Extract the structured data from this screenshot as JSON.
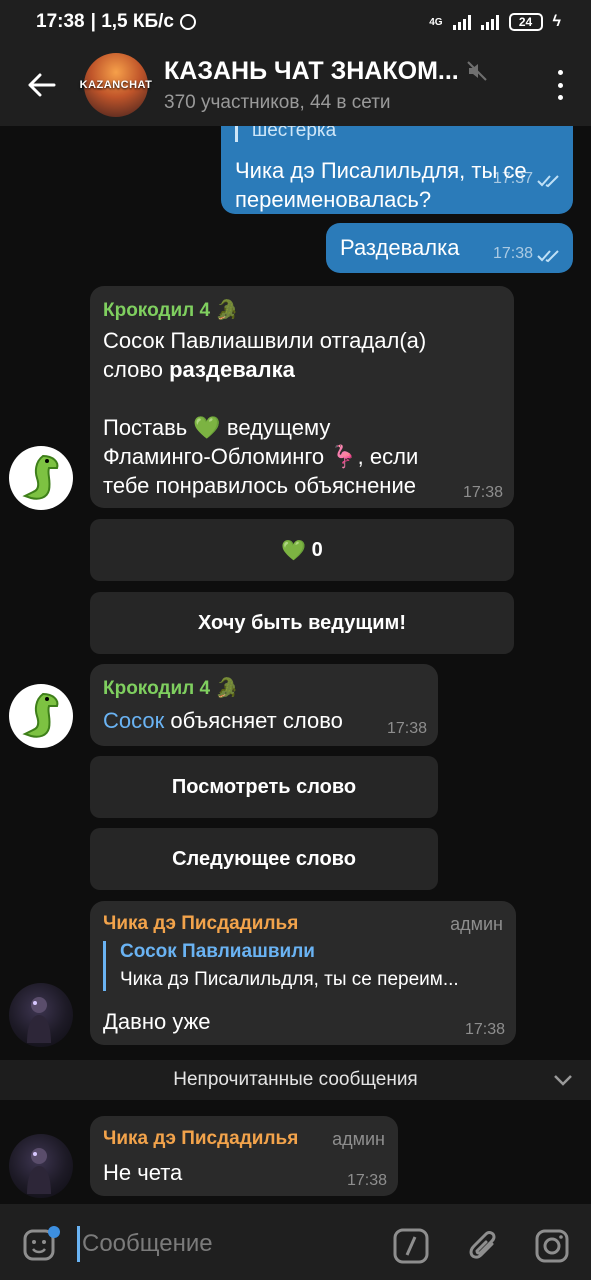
{
  "status": {
    "time": "17:38",
    "net": "| 1,5 КБ/с",
    "battery": "24",
    "tech": "4G"
  },
  "header": {
    "avatar_text": "KAZANCHAT",
    "title": "КАЗАНЬ ЧАТ ЗНАКОМ...",
    "subtitle": "370 участников, 44 в сети"
  },
  "messages": {
    "m1": {
      "cut_text": "шестерка",
      "text_1": "Чика дэ Писалильдля, ты се",
      "text_2": "переименовалась?",
      "time": "17:37"
    },
    "m2": {
      "text": "Раздевалка",
      "time": "17:38"
    },
    "m3": {
      "sender": "Крокодил 4",
      "line_1": "Сосок Павлиашвили отгадал(а)",
      "line_2a": "слово ",
      "line_2b": "раздевалка",
      "line_3a": "Поставь ",
      "line_3b": " ведущему",
      "line_4a": "Фламинго-Обломинго ",
      "line_4b": ", если",
      "line_5": "тебе понравилось объяснение",
      "time": "17:38"
    },
    "btn_like": {
      "emoji": "💚",
      "count": "0"
    },
    "btn_host": "Хочу быть ведущим!",
    "m4": {
      "sender": "Крокодил 4",
      "mention": "Сосок",
      "text": " объясняет слово",
      "time": "17:38"
    },
    "btn_view": "Посмотреть слово",
    "btn_next": "Следующее слово",
    "m5": {
      "sender": "Чика дэ Писдадилья",
      "admin": "админ",
      "reply_name": "Сосок Павлиашвили",
      "reply_text": "Чика дэ Писалильдля, ты се переим...",
      "text": "Давно уже",
      "time": "17:38"
    },
    "unread_label": "Непрочитанные сообщения",
    "m6": {
      "sender": "Чика дэ Писдадилья",
      "admin": "админ",
      "text": "Не чета",
      "time": "17:38"
    }
  },
  "emoji": {
    "croc": "🐊",
    "heart": "💚",
    "flamingo": "🦩"
  },
  "input": {
    "placeholder": "Сообщение"
  },
  "colors": {
    "outgoing": "#2b7bb9",
    "incoming": "#2a2a2a",
    "bot_name": "#7fcf5f",
    "admin_name": "#f2a34b",
    "link": "#6ab3f3"
  },
  "icons": [
    "back-arrow-icon",
    "mute-icon",
    "more-vert-icon",
    "double-check-icon",
    "chevron-down-icon",
    "sticker-icon",
    "bot-command-icon",
    "attach-icon",
    "camera-icon"
  ]
}
